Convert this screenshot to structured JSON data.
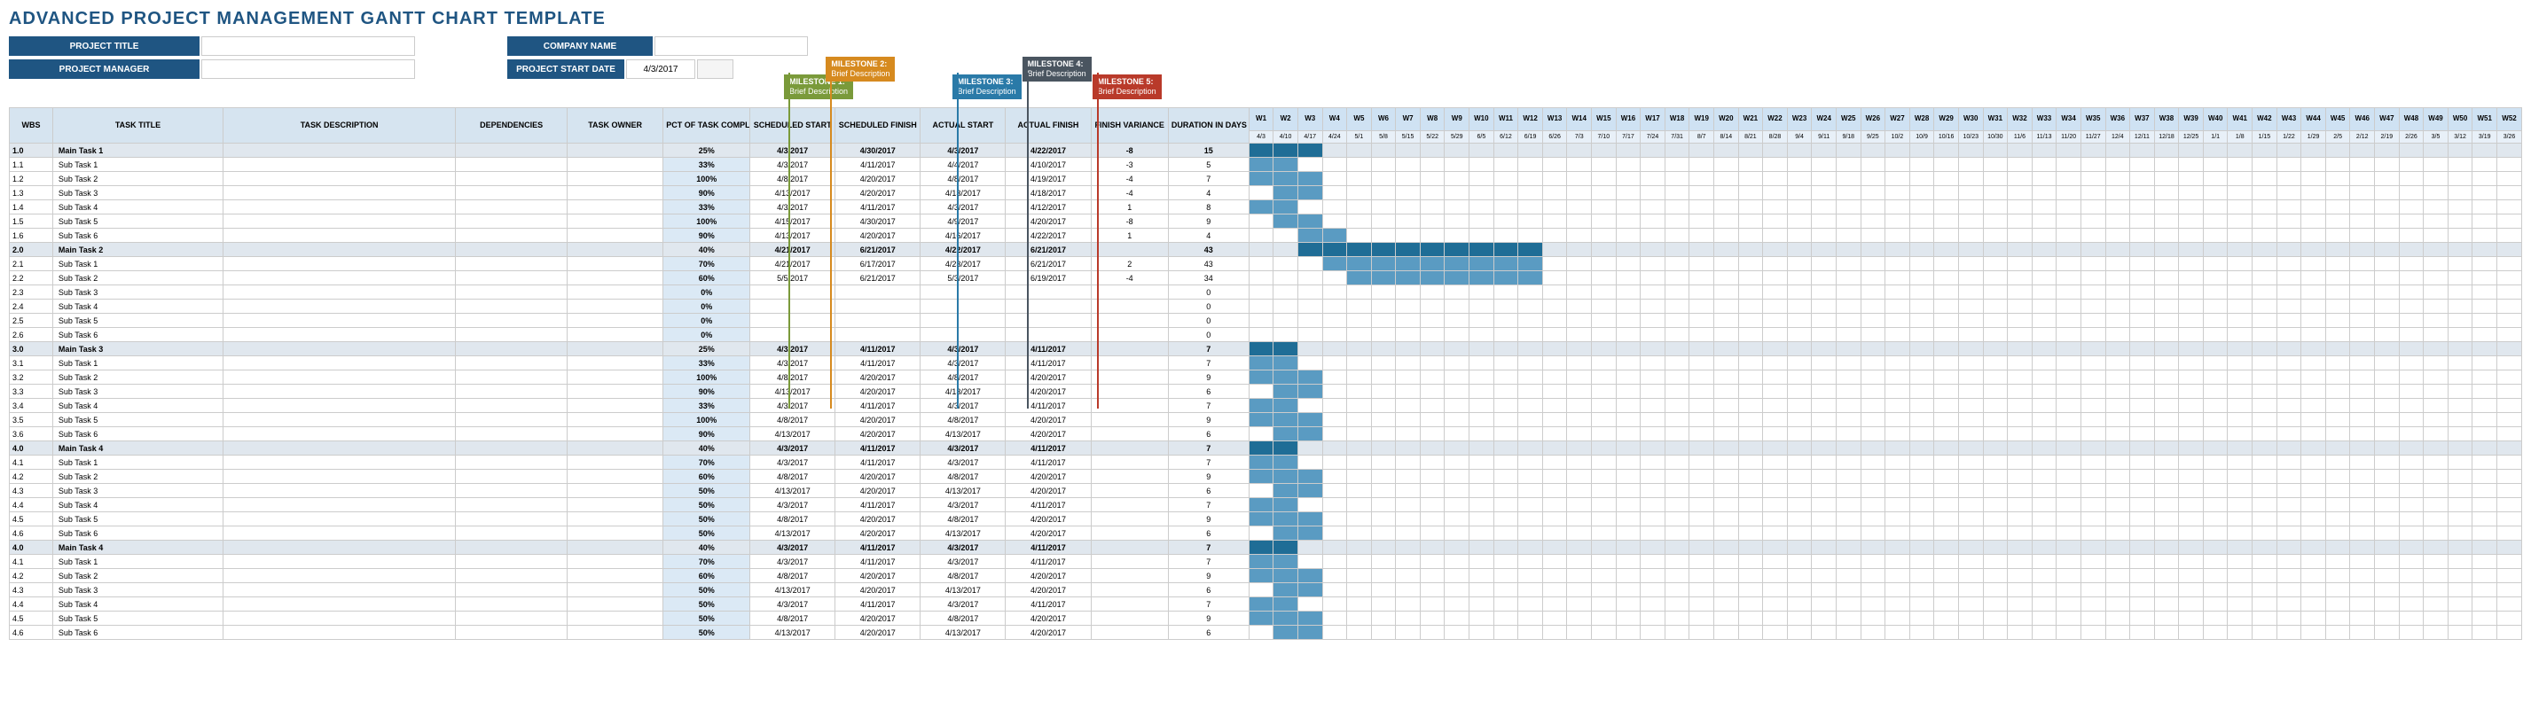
{
  "title": "ADVANCED PROJECT MANAGEMENT GANTT CHART TEMPLATE",
  "header": {
    "project_title_label": "PROJECT TITLE",
    "project_manager_label": "PROJECT MANAGER",
    "company_name_label": "COMPANY NAME",
    "project_start_date_label": "PROJECT START DATE",
    "project_start_date": "4/3/2017"
  },
  "milestones": [
    {
      "id": 1,
      "title": "MILESTONE 1:",
      "desc": "Brief Description",
      "color": "#7a9a3a",
      "week": 6
    },
    {
      "id": 2,
      "title": "MILESTONE 2:",
      "desc": "Brief Description",
      "color": "#d68a1f",
      "week": 9
    },
    {
      "id": 3,
      "title": "MILESTONE 3:",
      "desc": "Brief Description",
      "color": "#2a7aa8",
      "week": 18
    },
    {
      "id": 4,
      "title": "MILESTONE 4:",
      "desc": "Brief Description",
      "color": "#4a5560",
      "week": 23
    },
    {
      "id": 5,
      "title": "MILESTONE 5:",
      "desc": "Brief Description",
      "color": "#b93a2a",
      "week": 28
    }
  ],
  "columns": {
    "wbs": "WBS",
    "task": "TASK TITLE",
    "desc": "TASK DESCRIPTION",
    "dep": "DEPENDENCIES",
    "own": "TASK OWNER",
    "pct": "PCT OF TASK COMPLETE",
    "ss": "SCHEDULED START",
    "sf": "SCHEDULED FINISH",
    "as": "ACTUAL START",
    "af": "ACTUAL FINISH",
    "fv": "FINISH VARIANCE",
    "dur": "DURATION IN DAYS"
  },
  "weeks": [
    {
      "w": "W1",
      "d": "4/3"
    },
    {
      "w": "W2",
      "d": "4/10"
    },
    {
      "w": "W3",
      "d": "4/17"
    },
    {
      "w": "W4",
      "d": "4/24"
    },
    {
      "w": "W5",
      "d": "5/1"
    },
    {
      "w": "W6",
      "d": "5/8"
    },
    {
      "w": "W7",
      "d": "5/15"
    },
    {
      "w": "W8",
      "d": "5/22"
    },
    {
      "w": "W9",
      "d": "5/29"
    },
    {
      "w": "W10",
      "d": "6/5"
    },
    {
      "w": "W11",
      "d": "6/12"
    },
    {
      "w": "W12",
      "d": "6/19"
    },
    {
      "w": "W13",
      "d": "6/26"
    },
    {
      "w": "W14",
      "d": "7/3"
    },
    {
      "w": "W15",
      "d": "7/10"
    },
    {
      "w": "W16",
      "d": "7/17"
    },
    {
      "w": "W17",
      "d": "7/24"
    },
    {
      "w": "W18",
      "d": "7/31"
    },
    {
      "w": "W19",
      "d": "8/7"
    },
    {
      "w": "W20",
      "d": "8/14"
    },
    {
      "w": "W21",
      "d": "8/21"
    },
    {
      "w": "W22",
      "d": "8/28"
    },
    {
      "w": "W23",
      "d": "9/4"
    },
    {
      "w": "W24",
      "d": "9/11"
    },
    {
      "w": "W25",
      "d": "9/18"
    },
    {
      "w": "W26",
      "d": "9/25"
    },
    {
      "w": "W27",
      "d": "10/2"
    },
    {
      "w": "W28",
      "d": "10/9"
    },
    {
      "w": "W29",
      "d": "10/16"
    },
    {
      "w": "W30",
      "d": "10/23"
    },
    {
      "w": "W31",
      "d": "10/30"
    },
    {
      "w": "W32",
      "d": "11/6"
    },
    {
      "w": "W33",
      "d": "11/13"
    },
    {
      "w": "W34",
      "d": "11/20"
    },
    {
      "w": "W35",
      "d": "11/27"
    },
    {
      "w": "W36",
      "d": "12/4"
    },
    {
      "w": "W37",
      "d": "12/11"
    },
    {
      "w": "W38",
      "d": "12/18"
    },
    {
      "w": "W39",
      "d": "12/25"
    },
    {
      "w": "W40",
      "d": "1/1"
    },
    {
      "w": "W41",
      "d": "1/8"
    },
    {
      "w": "W42",
      "d": "1/15"
    },
    {
      "w": "W43",
      "d": "1/22"
    },
    {
      "w": "W44",
      "d": "1/29"
    },
    {
      "w": "W45",
      "d": "2/5"
    },
    {
      "w": "W46",
      "d": "2/12"
    },
    {
      "w": "W47",
      "d": "2/19"
    },
    {
      "w": "W48",
      "d": "2/26"
    },
    {
      "w": "W49",
      "d": "3/5"
    },
    {
      "w": "W50",
      "d": "3/12"
    },
    {
      "w": "W51",
      "d": "3/19"
    },
    {
      "w": "W52",
      "d": "3/26"
    }
  ],
  "rows": [
    {
      "wbs": "1.0",
      "task": "Main Task 1",
      "main": true,
      "pct": "25%",
      "ss": "4/3/2017",
      "sf": "4/30/2017",
      "as": "4/3/2017",
      "af": "4/22/2017",
      "fv": "-8",
      "dur": "15",
      "bar": [
        1,
        2,
        3
      ]
    },
    {
      "wbs": "1.1",
      "task": "Sub Task 1",
      "pct": "33%",
      "ss": "4/3/2017",
      "sf": "4/11/2017",
      "as": "4/4/2017",
      "af": "4/10/2017",
      "fv": "-3",
      "dur": "5",
      "bar": [
        1,
        2
      ]
    },
    {
      "wbs": "1.2",
      "task": "Sub Task 2",
      "pct": "100%",
      "ss": "4/8/2017",
      "sf": "4/20/2017",
      "as": "4/8/2017",
      "af": "4/19/2017",
      "fv": "-4",
      "dur": "7",
      "bar": [
        1,
        2,
        3
      ]
    },
    {
      "wbs": "1.3",
      "task": "Sub Task 3",
      "pct": "90%",
      "ss": "4/13/2017",
      "sf": "4/20/2017",
      "as": "4/13/2017",
      "af": "4/18/2017",
      "fv": "-4",
      "dur": "4",
      "bar": [
        2,
        3
      ]
    },
    {
      "wbs": "1.4",
      "task": "Sub Task 4",
      "pct": "33%",
      "ss": "4/3/2017",
      "sf": "4/11/2017",
      "as": "4/3/2017",
      "af": "4/12/2017",
      "fv": "1",
      "dur": "8",
      "bar": [
        1,
        2
      ]
    },
    {
      "wbs": "1.5",
      "task": "Sub Task 5",
      "pct": "100%",
      "ss": "4/15/2017",
      "sf": "4/30/2017",
      "as": "4/9/2017",
      "af": "4/20/2017",
      "fv": "-8",
      "dur": "9",
      "bar": [
        2,
        3
      ]
    },
    {
      "wbs": "1.6",
      "task": "Sub Task 6",
      "pct": "90%",
      "ss": "4/13/2017",
      "sf": "4/20/2017",
      "as": "4/16/2017",
      "af": "4/22/2017",
      "fv": "1",
      "dur": "4",
      "bar": [
        3,
        4
      ]
    },
    {
      "wbs": "2.0",
      "task": "Main Task 2",
      "main": true,
      "pct": "40%",
      "ss": "4/21/2017",
      "sf": "6/21/2017",
      "as": "4/22/2017",
      "af": "6/21/2017",
      "fv": "",
      "dur": "43",
      "bar": [
        3,
        4,
        5,
        6,
        7,
        8,
        9,
        10,
        11,
        12
      ]
    },
    {
      "wbs": "2.1",
      "task": "Sub Task 1",
      "pct": "70%",
      "ss": "4/21/2017",
      "sf": "6/17/2017",
      "as": "4/23/2017",
      "af": "6/21/2017",
      "fv": "2",
      "dur": "43",
      "bar": [
        4,
        5,
        6,
        7,
        8,
        9,
        10,
        11,
        12
      ]
    },
    {
      "wbs": "2.2",
      "task": "Sub Task 2",
      "pct": "60%",
      "ss": "5/5/2017",
      "sf": "6/21/2017",
      "as": "5/3/2017",
      "af": "6/19/2017",
      "fv": "-4",
      "dur": "34",
      "bar": [
        5,
        6,
        7,
        8,
        9,
        10,
        11,
        12
      ]
    },
    {
      "wbs": "2.3",
      "task": "Sub Task 3",
      "pct": "0%",
      "ss": "",
      "sf": "",
      "as": "",
      "af": "",
      "fv": "",
      "dur": "0",
      "bar": []
    },
    {
      "wbs": "2.4",
      "task": "Sub Task 4",
      "pct": "0%",
      "ss": "",
      "sf": "",
      "as": "",
      "af": "",
      "fv": "",
      "dur": "0",
      "bar": []
    },
    {
      "wbs": "2.5",
      "task": "Sub Task 5",
      "pct": "0%",
      "ss": "",
      "sf": "",
      "as": "",
      "af": "",
      "fv": "",
      "dur": "0",
      "bar": []
    },
    {
      "wbs": "2.6",
      "task": "Sub Task 6",
      "pct": "0%",
      "ss": "",
      "sf": "",
      "as": "",
      "af": "",
      "fv": "",
      "dur": "0",
      "bar": []
    },
    {
      "wbs": "3.0",
      "task": "Main Task 3",
      "main": true,
      "pct": "25%",
      "ss": "4/3/2017",
      "sf": "4/11/2017",
      "as": "4/3/2017",
      "af": "4/11/2017",
      "fv": "",
      "dur": "7",
      "bar": [
        1,
        2
      ]
    },
    {
      "wbs": "3.1",
      "task": "Sub Task 1",
      "pct": "33%",
      "ss": "4/3/2017",
      "sf": "4/11/2017",
      "as": "4/3/2017",
      "af": "4/11/2017",
      "fv": "",
      "dur": "7",
      "bar": [
        1,
        2
      ]
    },
    {
      "wbs": "3.2",
      "task": "Sub Task 2",
      "pct": "100%",
      "ss": "4/8/2017",
      "sf": "4/20/2017",
      "as": "4/8/2017",
      "af": "4/20/2017",
      "fv": "",
      "dur": "9",
      "bar": [
        1,
        2,
        3
      ]
    },
    {
      "wbs": "3.3",
      "task": "Sub Task 3",
      "pct": "90%",
      "ss": "4/13/2017",
      "sf": "4/20/2017",
      "as": "4/13/2017",
      "af": "4/20/2017",
      "fv": "",
      "dur": "6",
      "bar": [
        2,
        3
      ]
    },
    {
      "wbs": "3.4",
      "task": "Sub Task 4",
      "pct": "33%",
      "ss": "4/3/2017",
      "sf": "4/11/2017",
      "as": "4/3/2017",
      "af": "4/11/2017",
      "fv": "",
      "dur": "7",
      "bar": [
        1,
        2
      ]
    },
    {
      "wbs": "3.5",
      "task": "Sub Task 5",
      "pct": "100%",
      "ss": "4/8/2017",
      "sf": "4/20/2017",
      "as": "4/8/2017",
      "af": "4/20/2017",
      "fv": "",
      "dur": "9",
      "bar": [
        1,
        2,
        3
      ]
    },
    {
      "wbs": "3.6",
      "task": "Sub Task 6",
      "pct": "90%",
      "ss": "4/13/2017",
      "sf": "4/20/2017",
      "as": "4/13/2017",
      "af": "4/20/2017",
      "fv": "",
      "dur": "6",
      "bar": [
        2,
        3
      ]
    },
    {
      "wbs": "4.0",
      "task": "Main Task 4",
      "main": true,
      "pct": "40%",
      "ss": "4/3/2017",
      "sf": "4/11/2017",
      "as": "4/3/2017",
      "af": "4/11/2017",
      "fv": "",
      "dur": "7",
      "bar": [
        1,
        2
      ]
    },
    {
      "wbs": "4.1",
      "task": "Sub Task 1",
      "pct": "70%",
      "ss": "4/3/2017",
      "sf": "4/11/2017",
      "as": "4/3/2017",
      "af": "4/11/2017",
      "fv": "",
      "dur": "7",
      "bar": [
        1,
        2
      ]
    },
    {
      "wbs": "4.2",
      "task": "Sub Task 2",
      "pct": "60%",
      "ss": "4/8/2017",
      "sf": "4/20/2017",
      "as": "4/8/2017",
      "af": "4/20/2017",
      "fv": "",
      "dur": "9",
      "bar": [
        1,
        2,
        3
      ]
    },
    {
      "wbs": "4.3",
      "task": "Sub Task 3",
      "pct": "50%",
      "ss": "4/13/2017",
      "sf": "4/20/2017",
      "as": "4/13/2017",
      "af": "4/20/2017",
      "fv": "",
      "dur": "6",
      "bar": [
        2,
        3
      ]
    },
    {
      "wbs": "4.4",
      "task": "Sub Task 4",
      "pct": "50%",
      "ss": "4/3/2017",
      "sf": "4/11/2017",
      "as": "4/3/2017",
      "af": "4/11/2017",
      "fv": "",
      "dur": "7",
      "bar": [
        1,
        2
      ]
    },
    {
      "wbs": "4.5",
      "task": "Sub Task 5",
      "pct": "50%",
      "ss": "4/8/2017",
      "sf": "4/20/2017",
      "as": "4/8/2017",
      "af": "4/20/2017",
      "fv": "",
      "dur": "9",
      "bar": [
        1,
        2,
        3
      ]
    },
    {
      "wbs": "4.6",
      "task": "Sub Task 6",
      "pct": "50%",
      "ss": "4/13/2017",
      "sf": "4/20/2017",
      "as": "4/13/2017",
      "af": "4/20/2017",
      "fv": "",
      "dur": "6",
      "bar": [
        2,
        3
      ]
    },
    {
      "wbs": "4.0",
      "task": "Main Task 4",
      "main": true,
      "pct": "40%",
      "ss": "4/3/2017",
      "sf": "4/11/2017",
      "as": "4/3/2017",
      "af": "4/11/2017",
      "fv": "",
      "dur": "7",
      "bar": [
        1,
        2
      ]
    },
    {
      "wbs": "4.1",
      "task": "Sub Task 1",
      "pct": "70%",
      "ss": "4/3/2017",
      "sf": "4/11/2017",
      "as": "4/3/2017",
      "af": "4/11/2017",
      "fv": "",
      "dur": "7",
      "bar": [
        1,
        2
      ]
    },
    {
      "wbs": "4.2",
      "task": "Sub Task 2",
      "pct": "60%",
      "ss": "4/8/2017",
      "sf": "4/20/2017",
      "as": "4/8/2017",
      "af": "4/20/2017",
      "fv": "",
      "dur": "9",
      "bar": [
        1,
        2,
        3
      ]
    },
    {
      "wbs": "4.3",
      "task": "Sub Task 3",
      "pct": "50%",
      "ss": "4/13/2017",
      "sf": "4/20/2017",
      "as": "4/13/2017",
      "af": "4/20/2017",
      "fv": "",
      "dur": "6",
      "bar": [
        2,
        3
      ]
    },
    {
      "wbs": "4.4",
      "task": "Sub Task 4",
      "pct": "50%",
      "ss": "4/3/2017",
      "sf": "4/11/2017",
      "as": "4/3/2017",
      "af": "4/11/2017",
      "fv": "",
      "dur": "7",
      "bar": [
        1,
        2
      ]
    },
    {
      "wbs": "4.5",
      "task": "Sub Task 5",
      "pct": "50%",
      "ss": "4/8/2017",
      "sf": "4/20/2017",
      "as": "4/8/2017",
      "af": "4/20/2017",
      "fv": "",
      "dur": "9",
      "bar": [
        1,
        2,
        3
      ]
    },
    {
      "wbs": "4.6",
      "task": "Sub Task 6",
      "pct": "50%",
      "ss": "4/13/2017",
      "sf": "4/20/2017",
      "as": "4/13/2017",
      "af": "4/20/2017",
      "fv": "",
      "dur": "6",
      "bar": [
        2,
        3
      ]
    }
  ],
  "chart_data": {
    "type": "gantt",
    "title": "Advanced Project Management Gantt Chart",
    "x_unit": "week",
    "x_range": [
      "W1 4/3/2017",
      "W52 3/26/2018"
    ],
    "series": [
      {
        "name": "Main Task 1",
        "start_week": 1,
        "end_week": 3,
        "pct": 25
      },
      {
        "name": "Sub Task 1.1",
        "start_week": 1,
        "end_week": 2,
        "pct": 33
      },
      {
        "name": "Sub Task 1.2",
        "start_week": 1,
        "end_week": 3,
        "pct": 100
      },
      {
        "name": "Sub Task 1.3",
        "start_week": 2,
        "end_week": 3,
        "pct": 90
      },
      {
        "name": "Sub Task 1.4",
        "start_week": 1,
        "end_week": 2,
        "pct": 33
      },
      {
        "name": "Sub Task 1.5",
        "start_week": 2,
        "end_week": 3,
        "pct": 100
      },
      {
        "name": "Sub Task 1.6",
        "start_week": 3,
        "end_week": 4,
        "pct": 90
      },
      {
        "name": "Main Task 2",
        "start_week": 3,
        "end_week": 12,
        "pct": 40
      },
      {
        "name": "Sub Task 2.1",
        "start_week": 4,
        "end_week": 12,
        "pct": 70
      },
      {
        "name": "Sub Task 2.2",
        "start_week": 5,
        "end_week": 12,
        "pct": 60
      }
    ]
  }
}
